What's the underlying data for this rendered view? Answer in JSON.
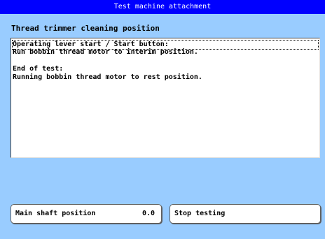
{
  "window": {
    "title": "Test machine attachment"
  },
  "heading": "Thread trimmer cleaning position",
  "text_lines": [
    "Operating lever start / Start button:",
    "Run bobbin thread motor to interim position.",
    "",
    "End of test:",
    "Running bobbin thread motor to rest position."
  ],
  "buttons": {
    "main_shaft_label": "Main shaft position",
    "main_shaft_value": "0.0",
    "stop_label": "Stop testing"
  },
  "colors": {
    "background": "#99ccff",
    "titlebar": "#0000ff"
  }
}
